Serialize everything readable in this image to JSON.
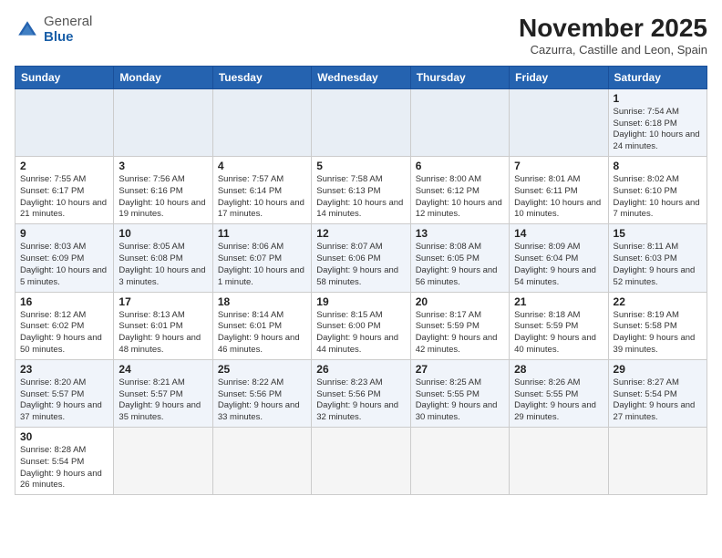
{
  "header": {
    "logo_general": "General",
    "logo_blue": "Blue",
    "title": "November 2025",
    "subtitle": "Cazurra, Castille and Leon, Spain"
  },
  "days_of_week": [
    "Sunday",
    "Monday",
    "Tuesday",
    "Wednesday",
    "Thursday",
    "Friday",
    "Saturday"
  ],
  "weeks": [
    [
      {
        "day": "",
        "info": ""
      },
      {
        "day": "",
        "info": ""
      },
      {
        "day": "",
        "info": ""
      },
      {
        "day": "",
        "info": ""
      },
      {
        "day": "",
        "info": ""
      },
      {
        "day": "",
        "info": ""
      },
      {
        "day": "1",
        "info": "Sunrise: 7:54 AM\nSunset: 6:18 PM\nDaylight: 10 hours and 24 minutes."
      }
    ],
    [
      {
        "day": "2",
        "info": "Sunrise: 7:55 AM\nSunset: 6:17 PM\nDaylight: 10 hours and 21 minutes."
      },
      {
        "day": "3",
        "info": "Sunrise: 7:56 AM\nSunset: 6:16 PM\nDaylight: 10 hours and 19 minutes."
      },
      {
        "day": "4",
        "info": "Sunrise: 7:57 AM\nSunset: 6:14 PM\nDaylight: 10 hours and 17 minutes."
      },
      {
        "day": "5",
        "info": "Sunrise: 7:58 AM\nSunset: 6:13 PM\nDaylight: 10 hours and 14 minutes."
      },
      {
        "day": "6",
        "info": "Sunrise: 8:00 AM\nSunset: 6:12 PM\nDaylight: 10 hours and 12 minutes."
      },
      {
        "day": "7",
        "info": "Sunrise: 8:01 AM\nSunset: 6:11 PM\nDaylight: 10 hours and 10 minutes."
      },
      {
        "day": "8",
        "info": "Sunrise: 8:02 AM\nSunset: 6:10 PM\nDaylight: 10 hours and 7 minutes."
      }
    ],
    [
      {
        "day": "9",
        "info": "Sunrise: 8:03 AM\nSunset: 6:09 PM\nDaylight: 10 hours and 5 minutes."
      },
      {
        "day": "10",
        "info": "Sunrise: 8:05 AM\nSunset: 6:08 PM\nDaylight: 10 hours and 3 minutes."
      },
      {
        "day": "11",
        "info": "Sunrise: 8:06 AM\nSunset: 6:07 PM\nDaylight: 10 hours and 1 minute."
      },
      {
        "day": "12",
        "info": "Sunrise: 8:07 AM\nSunset: 6:06 PM\nDaylight: 9 hours and 58 minutes."
      },
      {
        "day": "13",
        "info": "Sunrise: 8:08 AM\nSunset: 6:05 PM\nDaylight: 9 hours and 56 minutes."
      },
      {
        "day": "14",
        "info": "Sunrise: 8:09 AM\nSunset: 6:04 PM\nDaylight: 9 hours and 54 minutes."
      },
      {
        "day": "15",
        "info": "Sunrise: 8:11 AM\nSunset: 6:03 PM\nDaylight: 9 hours and 52 minutes."
      }
    ],
    [
      {
        "day": "16",
        "info": "Sunrise: 8:12 AM\nSunset: 6:02 PM\nDaylight: 9 hours and 50 minutes."
      },
      {
        "day": "17",
        "info": "Sunrise: 8:13 AM\nSunset: 6:01 PM\nDaylight: 9 hours and 48 minutes."
      },
      {
        "day": "18",
        "info": "Sunrise: 8:14 AM\nSunset: 6:01 PM\nDaylight: 9 hours and 46 minutes."
      },
      {
        "day": "19",
        "info": "Sunrise: 8:15 AM\nSunset: 6:00 PM\nDaylight: 9 hours and 44 minutes."
      },
      {
        "day": "20",
        "info": "Sunrise: 8:17 AM\nSunset: 5:59 PM\nDaylight: 9 hours and 42 minutes."
      },
      {
        "day": "21",
        "info": "Sunrise: 8:18 AM\nSunset: 5:59 PM\nDaylight: 9 hours and 40 minutes."
      },
      {
        "day": "22",
        "info": "Sunrise: 8:19 AM\nSunset: 5:58 PM\nDaylight: 9 hours and 39 minutes."
      }
    ],
    [
      {
        "day": "23",
        "info": "Sunrise: 8:20 AM\nSunset: 5:57 PM\nDaylight: 9 hours and 37 minutes."
      },
      {
        "day": "24",
        "info": "Sunrise: 8:21 AM\nSunset: 5:57 PM\nDaylight: 9 hours and 35 minutes."
      },
      {
        "day": "25",
        "info": "Sunrise: 8:22 AM\nSunset: 5:56 PM\nDaylight: 9 hours and 33 minutes."
      },
      {
        "day": "26",
        "info": "Sunrise: 8:23 AM\nSunset: 5:56 PM\nDaylight: 9 hours and 32 minutes."
      },
      {
        "day": "27",
        "info": "Sunrise: 8:25 AM\nSunset: 5:55 PM\nDaylight: 9 hours and 30 minutes."
      },
      {
        "day": "28",
        "info": "Sunrise: 8:26 AM\nSunset: 5:55 PM\nDaylight: 9 hours and 29 minutes."
      },
      {
        "day": "29",
        "info": "Sunrise: 8:27 AM\nSunset: 5:54 PM\nDaylight: 9 hours and 27 minutes."
      }
    ],
    [
      {
        "day": "30",
        "info": "Sunrise: 8:28 AM\nSunset: 5:54 PM\nDaylight: 9 hours and 26 minutes."
      },
      {
        "day": "",
        "info": ""
      },
      {
        "day": "",
        "info": ""
      },
      {
        "day": "",
        "info": ""
      },
      {
        "day": "",
        "info": ""
      },
      {
        "day": "",
        "info": ""
      },
      {
        "day": "",
        "info": ""
      }
    ]
  ]
}
